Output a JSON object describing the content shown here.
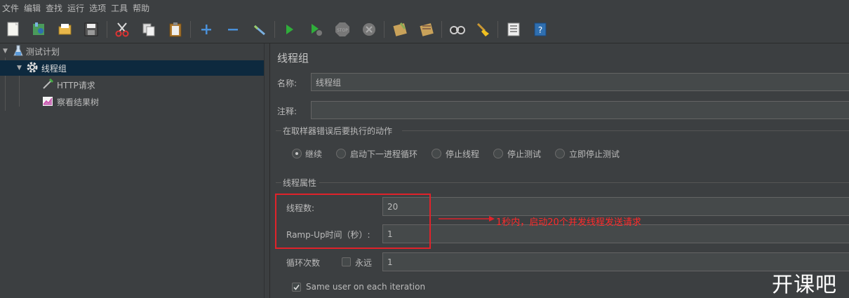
{
  "menu": [
    "文件",
    "编辑",
    "查找",
    "运行",
    "选项",
    "工具",
    "帮助"
  ],
  "toolbar_icons": [
    "new-icon",
    "templates-icon",
    "open-icon",
    "save-icon",
    "cut-icon",
    "copy-icon",
    "paste-icon",
    "expand-icon",
    "collapse-icon",
    "toggle-icon",
    "start-icon",
    "start-no-pause-icon",
    "stop-icon",
    "shutdown-icon",
    "clear-icon",
    "clear-all-icon",
    "search-icon",
    "reset-search-icon",
    "function-helper-icon",
    "help-icon"
  ],
  "tree": {
    "test_plan": "测试计划",
    "thread_group": "线程组",
    "http_request": "HTTP请求",
    "result_tree": "察看结果树"
  },
  "panel": {
    "title": "线程组",
    "name_label": "名称:",
    "name_value": "线程组",
    "comment_label": "注释:",
    "comment_value": "",
    "error_action_title": "在取样器错误后要执行的动作",
    "error_actions": [
      "继续",
      "启动下一进程循环",
      "停止线程",
      "停止测试",
      "立即停止测试"
    ],
    "thread_props_title": "线程属性",
    "threads_label": "线程数:",
    "threads_value": "20",
    "rampup_label": "Ramp-Up时间（秒）:",
    "rampup_value": "1",
    "loop_label": "循环次数",
    "forever_label": "永远",
    "loop_value": "1",
    "same_user_label": "Same user on each iteration"
  },
  "annotation": "1秒内，启动20个并发线程发送请求",
  "watermark": "开课吧",
  "colors": {
    "background": "#3c3f41",
    "selection": "#0d293e",
    "field_bg": "#45494a",
    "annotation_red": "#e0222a"
  }
}
